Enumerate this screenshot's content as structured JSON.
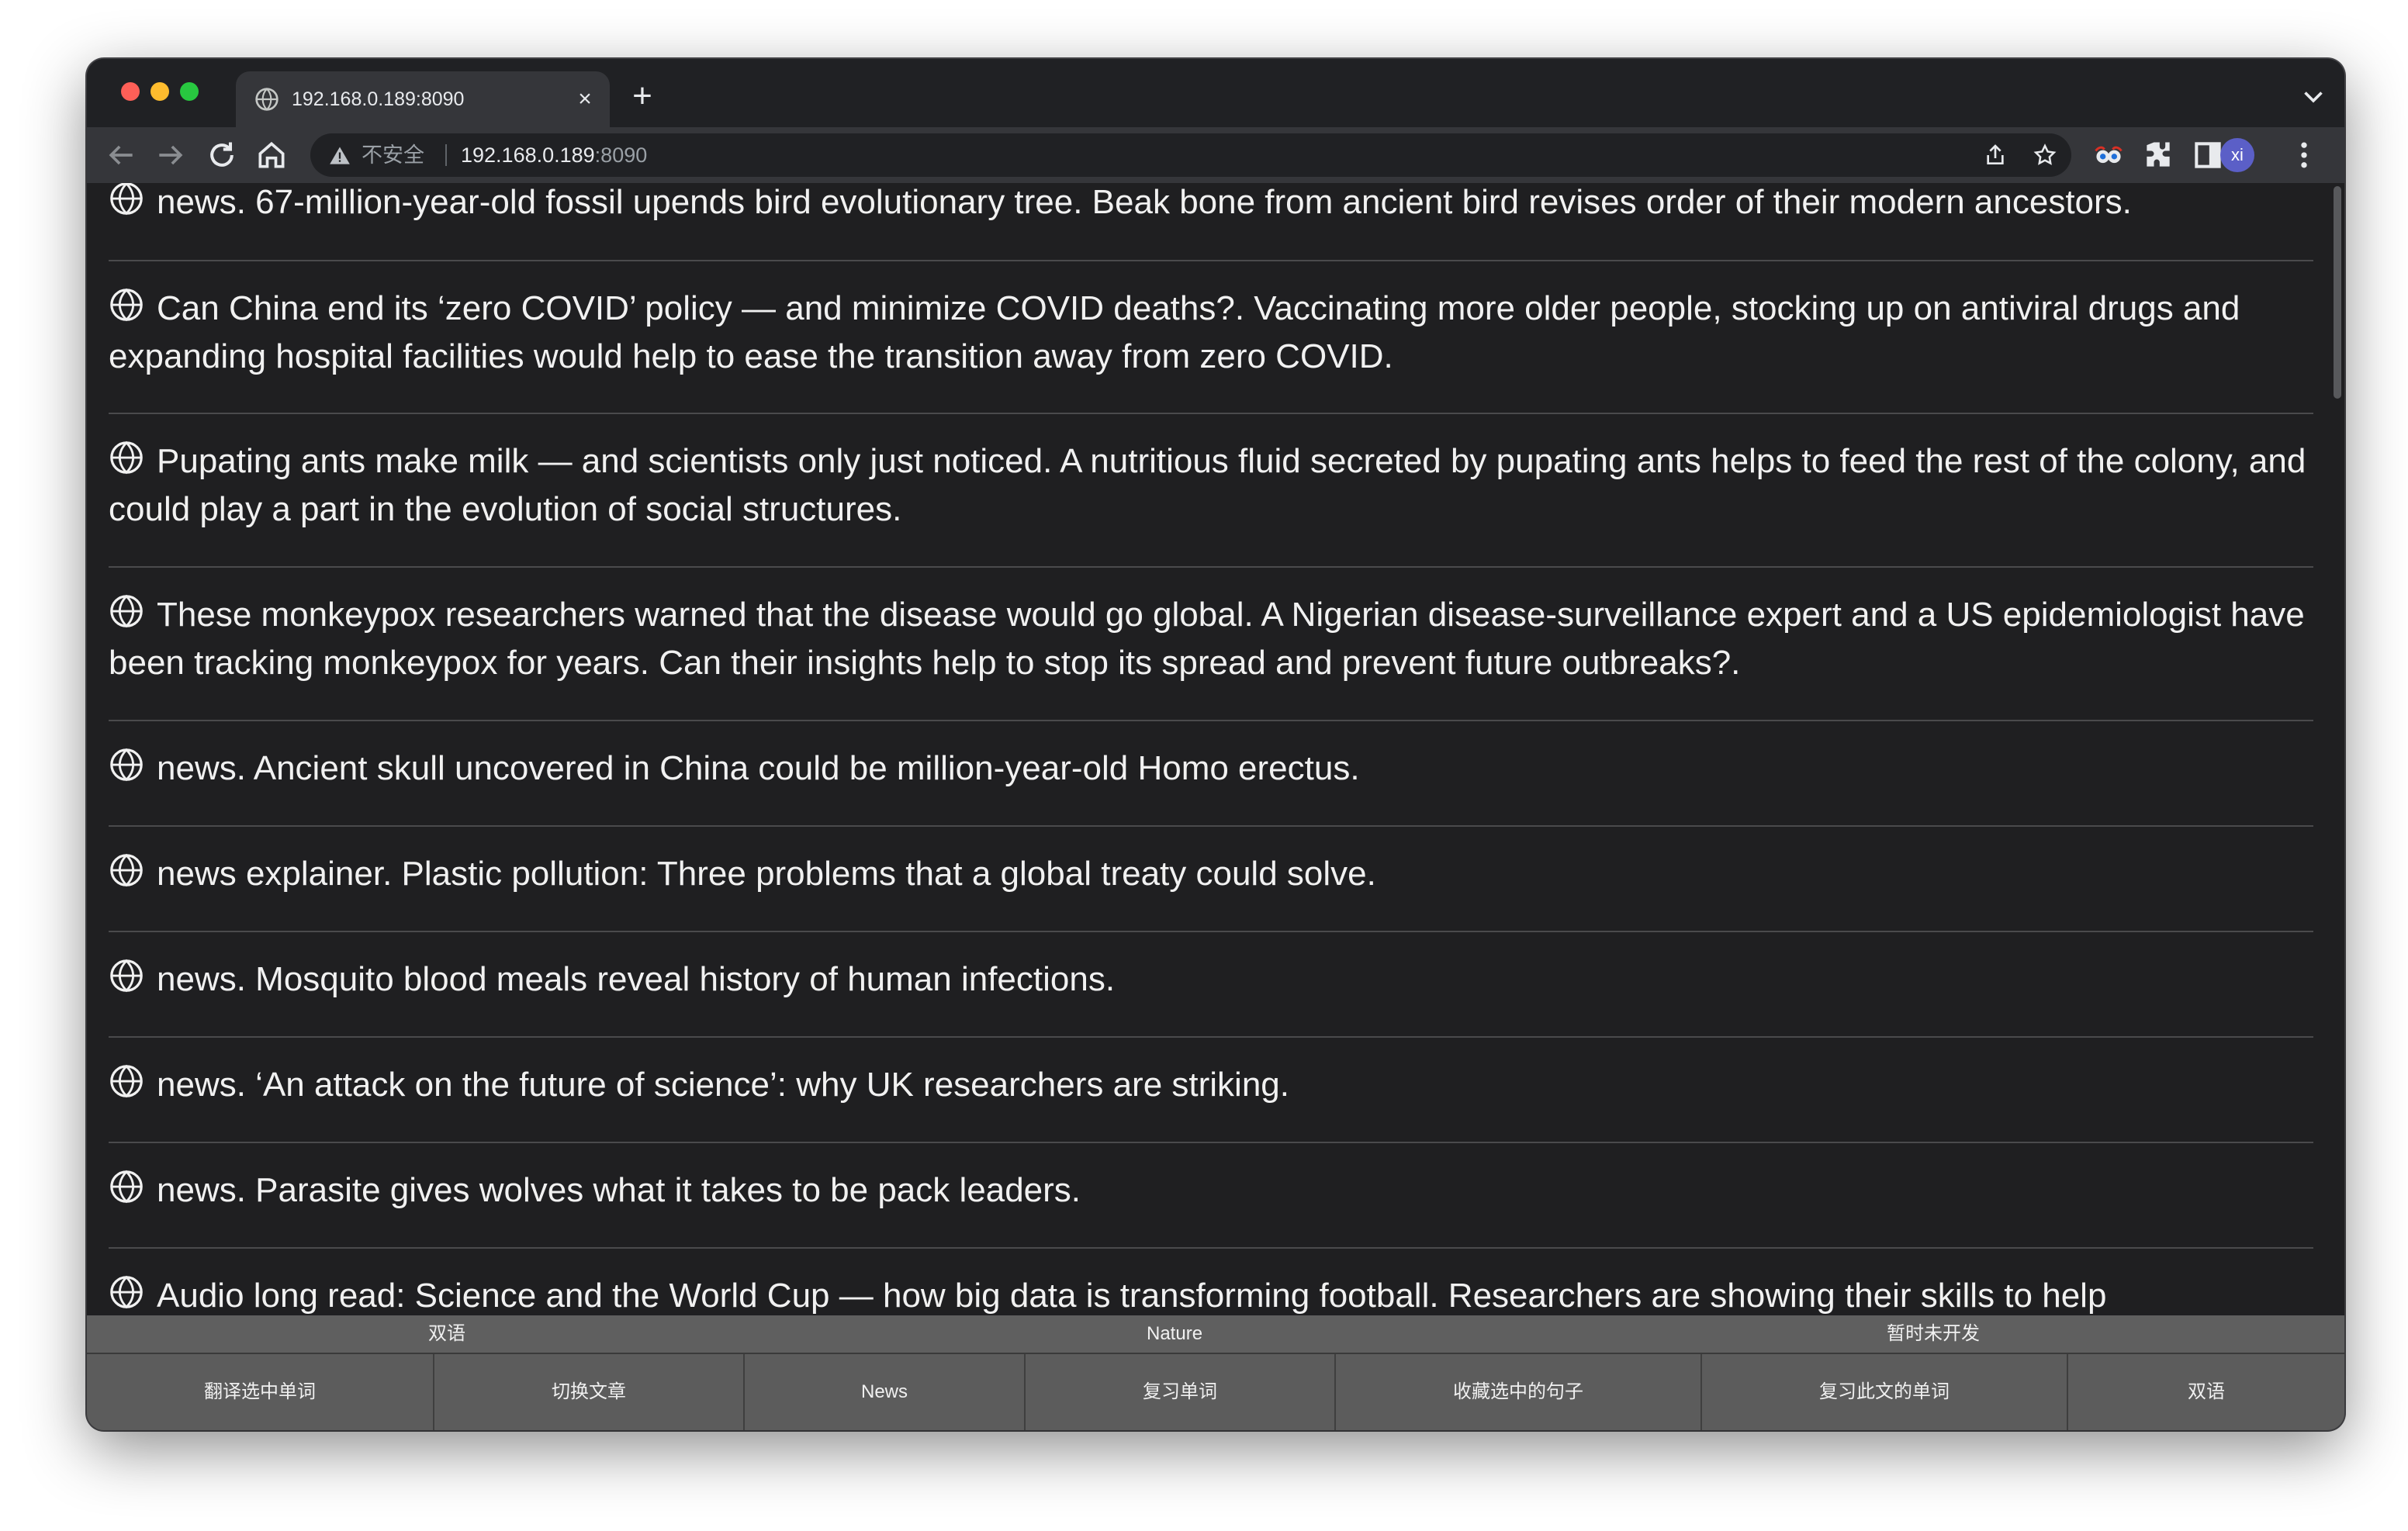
{
  "browser": {
    "tab_title": "192.168.0.189:8090",
    "tab_close": "×",
    "new_tab": "+",
    "insecure_label": "不安全",
    "url_host": "192.168.0.189",
    "url_port": ":8090",
    "avatar_initials": "xi"
  },
  "articles": [
    "news. 67-million-year-old fossil upends bird evolutionary tree. Beak bone from ancient bird revises order of their modern ancestors.",
    "Can China end its ‘zero COVID’ policy — and minimize COVID deaths?. Vaccinating more older people, stocking up on antiviral drugs and expanding hospital facilities would help to ease the transition away from zero COVID.",
    "Pupating ants make milk — and scientists only just noticed. A nutritious fluid secreted by pupating ants helps to feed the rest of the colony, and could play a part in the evolution of social structures.",
    "These monkeypox researchers warned that the disease would go global. A Nigerian disease-surveillance expert and a US epidemiologist have been tracking monkeypox for years. Can their insights help to stop its spread and prevent future outbreaks?.",
    "news. Ancient skull uncovered in China could be million-year-old Homo erectus.",
    "news explainer. Plastic pollution: Three problems that a global treaty could solve.",
    "news. Mosquito blood meals reveal history of human infections.",
    "news. ‘An attack on the future of science’: why UK researchers are striking.",
    "news. Parasite gives wolves what it takes to be pack leaders.",
    "Audio long read: Science and the World Cup — how big data is transforming football. Researchers are showing their skills to help"
  ],
  "bottom_bar": {
    "top_labels": [
      "双语",
      "Nature",
      "暂时未开发"
    ],
    "buttons": [
      "翻译选中单词",
      "切换文章",
      "News",
      "复习单词",
      "收藏选中的句子",
      "复习此文的单词",
      "双语"
    ]
  }
}
